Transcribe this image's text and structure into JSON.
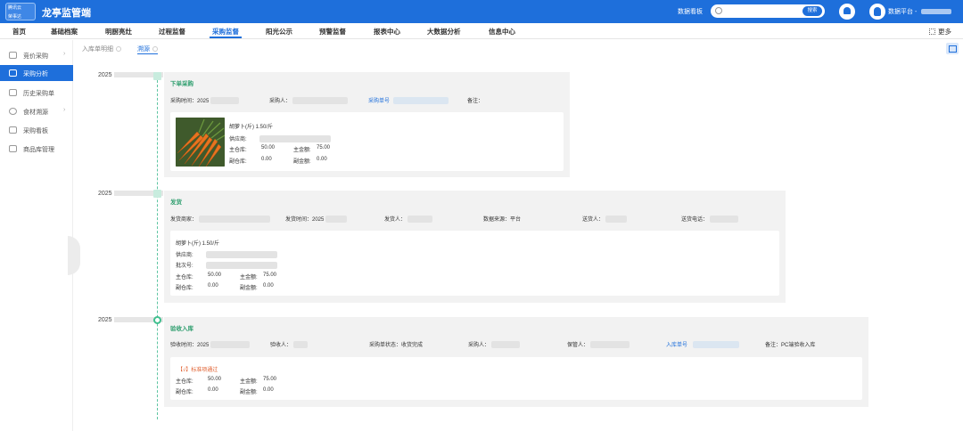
{
  "header": {
    "logo_line1": "腾讯云",
    "logo_line2": "荣事达",
    "app_title": "龙亭监管端",
    "data_board": "数据看板",
    "search_placeholder": "",
    "search_button": "搜索",
    "user_name": "数据平台 -"
  },
  "nav": {
    "items": [
      "首页",
      "基础档案",
      "明厨亮灶",
      "过程监督",
      "采购监督",
      "阳光公示",
      "预警监督",
      "报表中心",
      "大数据分析",
      "信息中心"
    ],
    "active": "采购监督",
    "more": "更多"
  },
  "sidebar": {
    "items": [
      {
        "label": "竞价采购",
        "icon": "bid-icon",
        "arrow": "›"
      },
      {
        "label": "采购分析",
        "icon": "analysis-icon",
        "arrow": ""
      },
      {
        "label": "历史采购单",
        "icon": "history-icon",
        "arrow": ""
      },
      {
        "label": "食材溯源",
        "icon": "trace-icon",
        "arrow": "›"
      },
      {
        "label": "采购看板",
        "icon": "board-icon",
        "arrow": ""
      },
      {
        "label": "商品库管理",
        "icon": "product-icon",
        "arrow": ""
      }
    ],
    "active": "采购分析"
  },
  "tabs": [
    {
      "label": "入库单明细",
      "active": false
    },
    {
      "label": "溯源",
      "active": true
    }
  ],
  "timeline": [
    {
      "date": "2025",
      "title": "下单采购",
      "info": {
        "time_label": "采购时间：2025",
        "buyer_label": "采购人：",
        "order_no_label": "采购单号",
        "remark_label": "备注："
      },
      "item": {
        "name": "胡萝卜(斤) 1.50/斤",
        "supplier_label": "供应商:",
        "main_store_label": "主仓库:",
        "main_store_value": "50.00",
        "main_amount_label": "主金额:",
        "main_amount_value": "75.00",
        "sub_store_label": "副仓库:",
        "sub_store_value": "0.00",
        "sub_amount_label": "副金额:",
        "sub_amount_value": "0.00"
      }
    },
    {
      "date": "2025",
      "title": "发货",
      "info": {
        "merchant_label": "发货商家：",
        "time_label": "发货时间：2025",
        "sender_label": "发货人：",
        "source_label": "数据来源：平台",
        "deliverer_label": "送货人：",
        "phone_label": "送货电话："
      },
      "item": {
        "name": "胡萝卜(斤) 1.50/斤",
        "supplier_label": "供应商:",
        "batch_label": "批次号:",
        "main_store_label": "主仓库:",
        "main_store_value": "50.00",
        "main_amount_label": "主金额:",
        "main_amount_value": "75.00",
        "sub_store_label": "副仓库:",
        "sub_store_value": "0.00",
        "sub_amount_label": "副金额:",
        "sub_amount_value": "0.00"
      }
    },
    {
      "date": "2025",
      "title": "验收入库",
      "info": {
        "time_label": "验收时间：2025",
        "inspector_label": "验收人：",
        "status_label": "采购单状态：收货完成",
        "buyer_label": "采购人：",
        "keeper_label": "保管人：",
        "store_no_label": "入库单号",
        "remark_label": "备注：PC端验收入库"
      },
      "item": {
        "name": "【√】标准项通过",
        "main_store_label": "主仓库:",
        "main_store_value": "50.00",
        "main_amount_label": "主金额:",
        "main_amount_value": "75.00",
        "sub_store_label": "副仓库:",
        "sub_store_value": "0.00",
        "sub_amount_label": "副金额:",
        "sub_amount_value": "0.00"
      }
    }
  ],
  "colors": {
    "brand": "#1e6fdb",
    "stage_title": "#2e9e6e",
    "timeline": "#5ec5a2",
    "accept_text": "#e06030"
  }
}
